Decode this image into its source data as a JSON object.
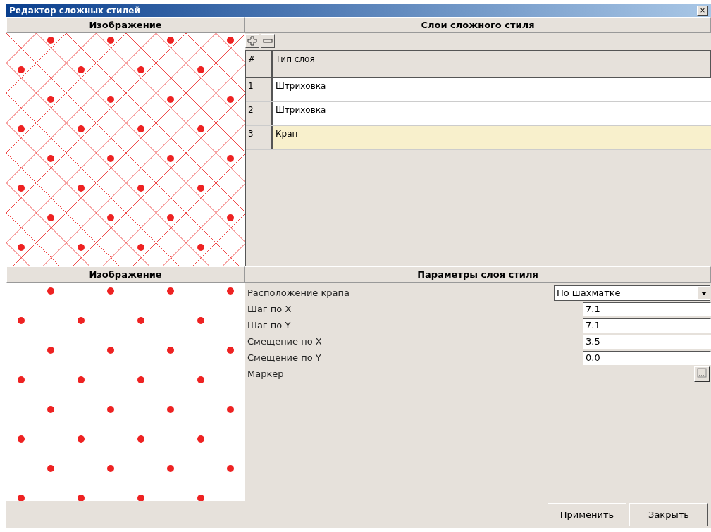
{
  "window": {
    "title": "Редактор сложных стилей",
    "close_glyph": "×"
  },
  "top_left": {
    "header": "Изображение"
  },
  "layers": {
    "header": "Слои сложного стиля",
    "columns": [
      "#",
      "Тип слоя"
    ],
    "rows": [
      {
        "index": "1",
        "type": "Штриховка",
        "selected": false
      },
      {
        "index": "2",
        "type": "Штриховка",
        "selected": false
      },
      {
        "index": "3",
        "type": "Крап",
        "selected": true
      }
    ]
  },
  "bottom_left": {
    "header": "Изображение"
  },
  "params": {
    "header": "Параметры слоя стиля",
    "rows": [
      {
        "kind": "dropdown",
        "label": "Расположение крапа",
        "value": "По шахматке"
      },
      {
        "kind": "number",
        "label": "Шаг по X",
        "value": "7.1"
      },
      {
        "kind": "number",
        "label": "Шаг по Y",
        "value": "7.1"
      },
      {
        "kind": "number",
        "label": "Смещение по X",
        "value": "3.5"
      },
      {
        "kind": "number",
        "label": "Смещение по Y",
        "value": "0.0"
      },
      {
        "kind": "marker",
        "label": "Маркер"
      }
    ]
  },
  "buttons": [
    "Применить",
    "Закрыть"
  ]
}
